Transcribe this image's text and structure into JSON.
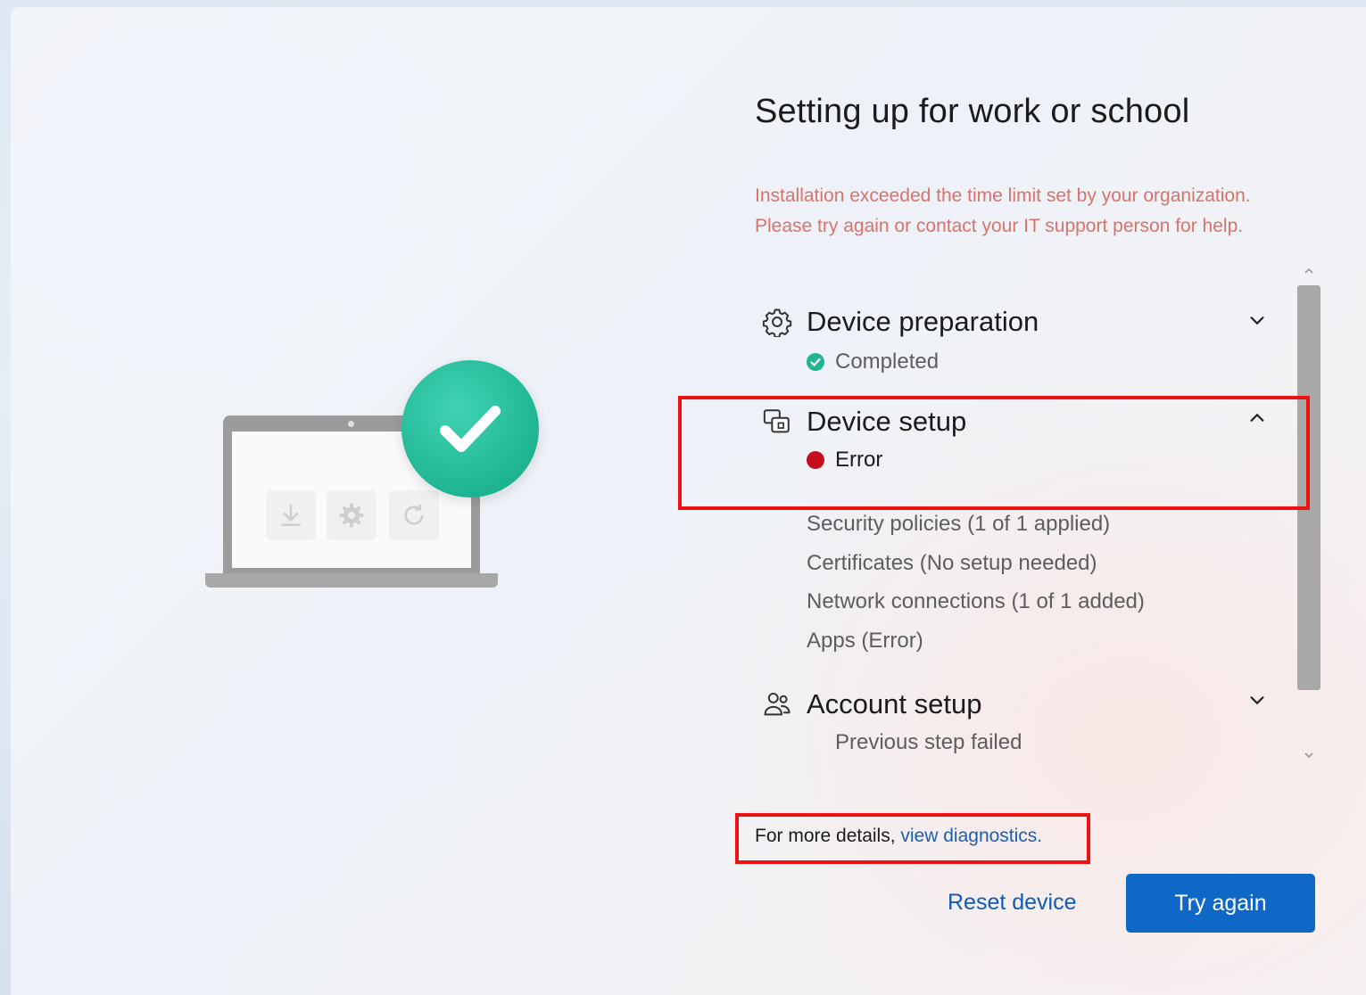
{
  "page": {
    "title": "Setting up for work or school",
    "error_message": [
      "Installation exceeded the time limit set by your organization.",
      "Please try again or contact your IT support person for help."
    ]
  },
  "sections": [
    {
      "title": "Device preparation",
      "status": "Completed",
      "status_kind": "success",
      "icon": "gear-icon",
      "expanded": false
    },
    {
      "title": "Device setup",
      "status": "Error",
      "status_kind": "error",
      "icon": "device-setup-icon",
      "expanded": true,
      "sub_items": [
        "Security policies (1 of 1 applied)",
        "Certificates (No setup needed)",
        "Network connections (1 of 1 added)",
        "Apps (Error)"
      ]
    },
    {
      "title": "Account setup",
      "status": "Previous step failed",
      "status_kind": "none",
      "icon": "people-icon",
      "expanded": false
    }
  ],
  "footer": {
    "details_prefix": "For more details, ",
    "details_link": "view diagnostics.",
    "reset_label": "Reset device",
    "try_again_label": "Try again"
  },
  "colors": {
    "accent": "#0f67c6",
    "success": "#1fb592",
    "error": "#c50f1f",
    "error_text": "#d9726b",
    "highlight": "#ee1111"
  }
}
